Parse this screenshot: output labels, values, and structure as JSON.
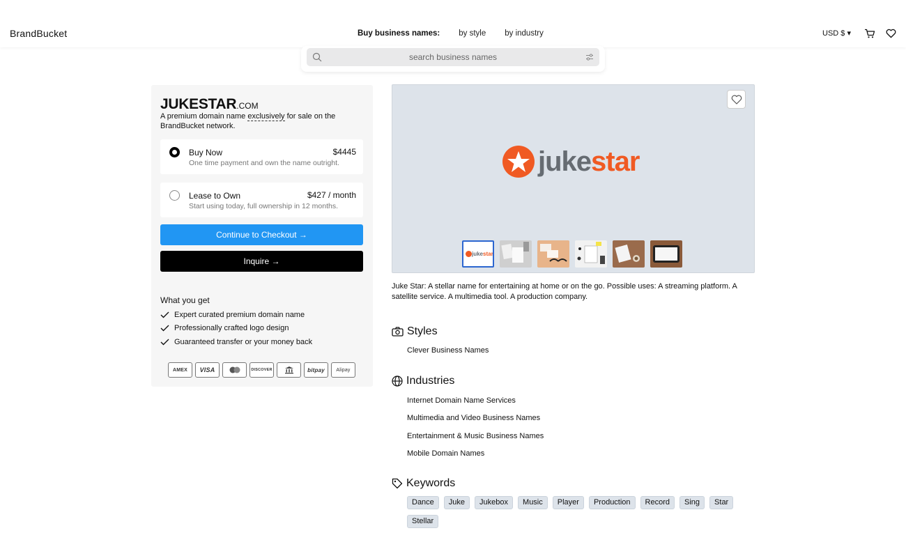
{
  "header": {
    "logo": "BrandBucket",
    "nav_lead": "Buy business names:",
    "nav_links": [
      "by style",
      "by industry"
    ],
    "currency": "USD $ ▾"
  },
  "search": {
    "placeholder": "search business names"
  },
  "listing": {
    "name": "JUKESTAR",
    "tld": ".COM",
    "subtitle_before": "A premium domain name ",
    "subtitle_emph": "exclusively",
    "subtitle_after": " for sale on the BrandBucket network.",
    "options": [
      {
        "label": "Buy Now",
        "price": "$4445",
        "desc": "One time payment and own the name outright."
      },
      {
        "label": "Lease to Own",
        "price": "$427 / month",
        "desc": "Start using today, full ownership in 12 months."
      }
    ],
    "checkout_label": "Continue to Checkout →",
    "inquire_label": "Inquire →",
    "what_you_get_title": "What you get",
    "what_you_get": [
      "Expert curated premium domain name",
      "Professionally crafted logo design",
      "Guaranteed transfer or your money back"
    ],
    "payment_methods": [
      "AMEX",
      "VISA",
      "",
      "DISCOVER",
      "",
      "bitpay",
      "Alipay"
    ]
  },
  "hero": {
    "brand_part1": "juke",
    "brand_part2": "star",
    "thumb_label_part1": "juke",
    "thumb_label_part2": "star",
    "accent_color": "#f05a23",
    "gray_color": "#666c72"
  },
  "description": "Juke Star: A stellar name for entertaining at home or on the go. Possible uses: A streaming platform. A satellite service. A multimedia tool. A production company.",
  "styles": {
    "title": "Styles",
    "items": [
      "Clever Business Names"
    ]
  },
  "industries": {
    "title": "Industries",
    "items": [
      "Internet Domain Name Services",
      "Multimedia and Video Business Names",
      "Entertainment & Music Business Names",
      "Mobile Domain Names"
    ]
  },
  "keywords": {
    "title": "Keywords",
    "items": [
      "Dance",
      "Juke",
      "Jukebox",
      "Music",
      "Player",
      "Production",
      "Record",
      "Sing",
      "Star",
      "Stellar"
    ]
  }
}
